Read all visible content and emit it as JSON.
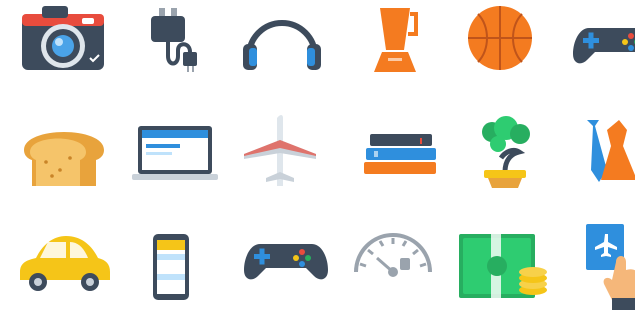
{
  "icons": [
    "camera-icon",
    "power-plug-icon",
    "headphones-icon",
    "blender-icon",
    "basketball-icon",
    "gamepad-icon",
    "bread-icon",
    "laptop-icon",
    "airplane-icon",
    "books-icon",
    "bonsai-tree-icon",
    "tie-and-dress-icon",
    "car-icon",
    "smartphone-icon",
    "gamepad-icon",
    "speedometer-gauge-icon",
    "money-stack-icon",
    "touch-ticket-icon"
  ],
  "colors": {
    "navy": "#3d4b5c",
    "blue": "#2f8fdd",
    "orange": "#f47b20",
    "yellow": "#f5c518",
    "tan": "#e8a33c",
    "green": "#27ae60",
    "red": "#e84c3d",
    "gray": "#9aa3ad"
  }
}
